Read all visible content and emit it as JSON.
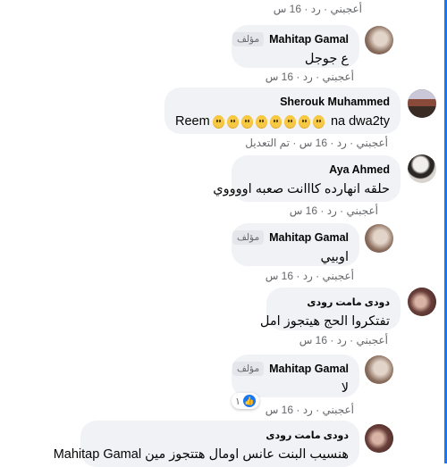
{
  "comments": [
    {
      "id": "c0",
      "meta": {
        "like": "أعجبني",
        "reply": "رد",
        "time": "16 س"
      }
    },
    {
      "id": "c1",
      "author": "Mahitap Gamal",
      "badge": "مؤلف",
      "text": "ع جوجل",
      "meta": {
        "like": "أعجبني",
        "reply": "رد",
        "time": "16 س"
      }
    },
    {
      "id": "c2",
      "author": "Sherouk Muhammed",
      "text_prefix": "Reem",
      "emoji_count": 8,
      "text_suffix": "na dwa2ty",
      "meta": {
        "like": "أعجبني",
        "reply": "رد",
        "time": "16 س",
        "edited": "تم التعديل"
      }
    },
    {
      "id": "c3",
      "author": "Aya Ahmed",
      "text": "حلقه انهارده كااانت صعبه اووووي",
      "meta": {
        "like": "أعجبني",
        "reply": "رد",
        "time": "16 س"
      }
    },
    {
      "id": "c4",
      "author": "Mahitap Gamal",
      "badge": "مؤلف",
      "text": "اوبيي",
      "meta": {
        "like": "أعجبني",
        "reply": "رد",
        "time": "16 س"
      }
    },
    {
      "id": "c5",
      "author": "دودى مامت رودى",
      "text": "تفتكروا الحج هيتجوز امل",
      "meta": {
        "like": "أعجبني",
        "reply": "رد",
        "time": "16 س"
      }
    },
    {
      "id": "c6",
      "author": "Mahitap Gamal",
      "badge": "مؤلف",
      "text": "لا",
      "reactions": "١",
      "meta": {
        "like": "أعجبني",
        "reply": "رد",
        "time": "16 س"
      }
    },
    {
      "id": "c7",
      "author": "دودى مامت رودى",
      "text": "هنسيب البنت عانس اومال هتتجوز مين Mahitap Gamal"
    }
  ],
  "colors": {
    "bubble": "#f0f2f5",
    "meta": "#65676b",
    "like_blue": "#1877f2"
  }
}
